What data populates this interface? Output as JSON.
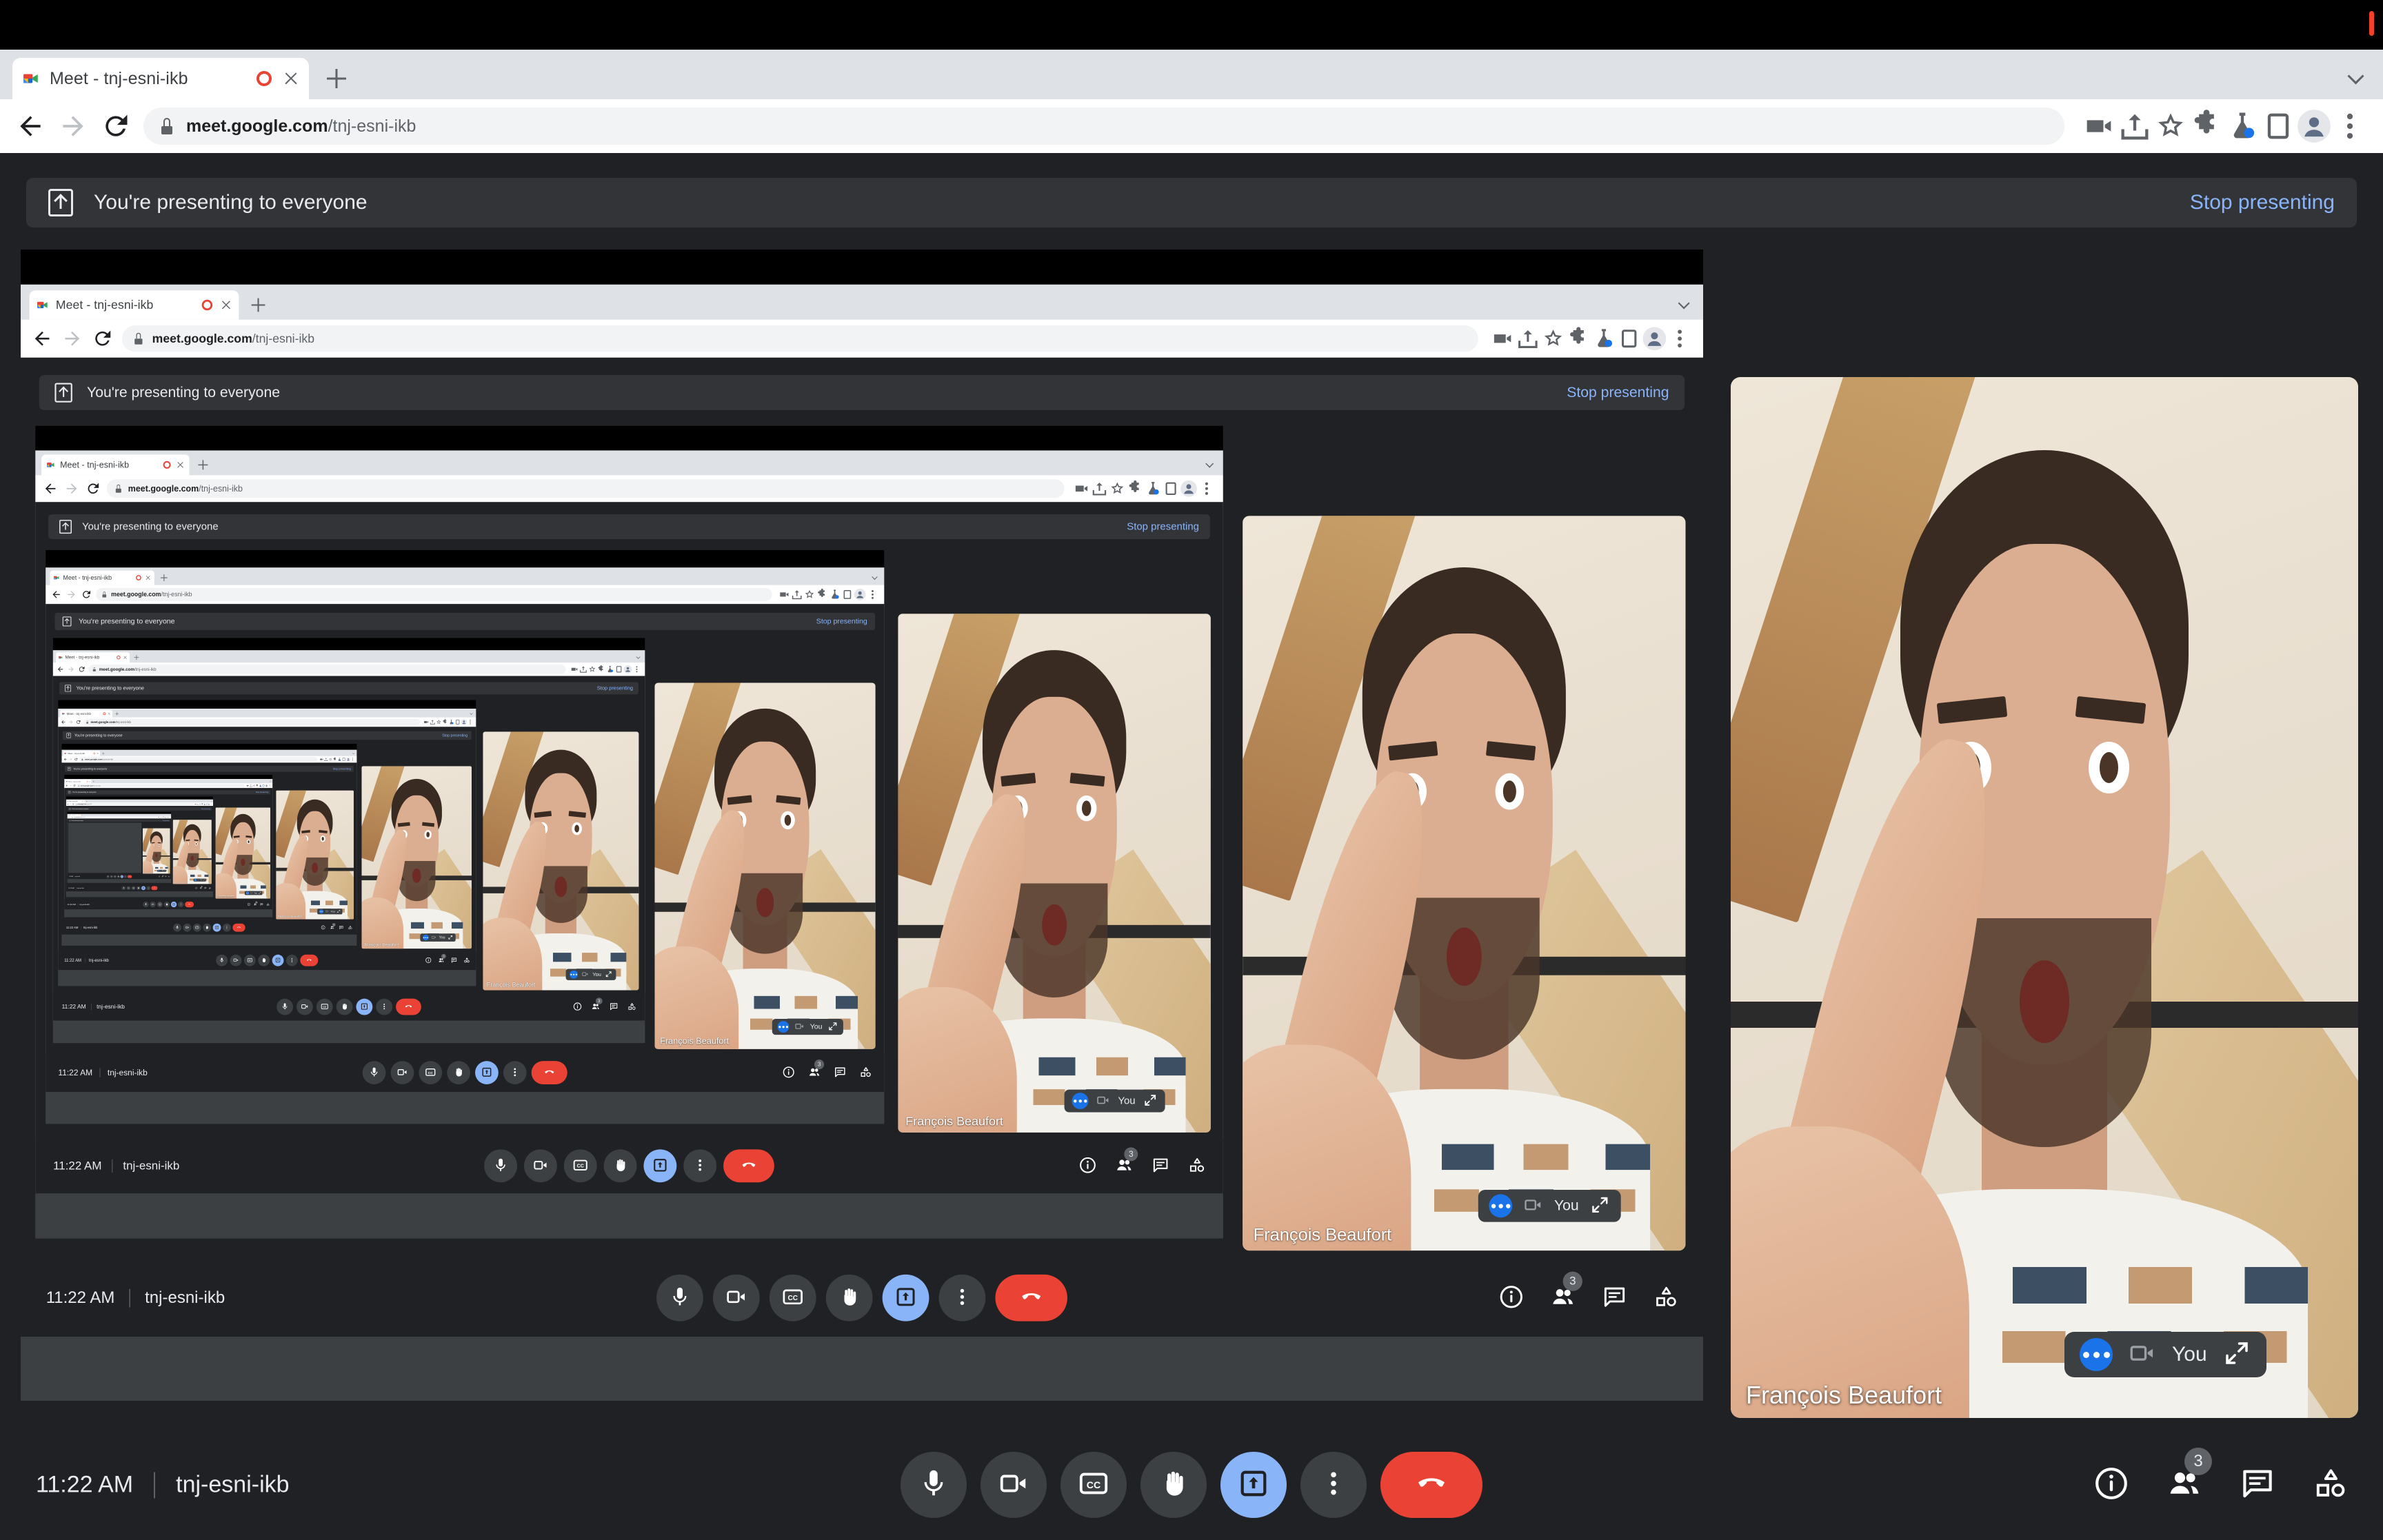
{
  "window": {
    "top_bar_color": "#000000",
    "tab": {
      "title": "Meet - tnj-esni-ikb",
      "favicon_name": "google-meet-favicon",
      "recording_indicator": "recording-dot",
      "close_label": "×"
    },
    "new_tab_label": "+",
    "tabstrip_caret": "chevron-down-icon",
    "nav": {
      "back": "back-arrow-icon",
      "forward": "forward-arrow-icon",
      "reload": "reload-icon"
    },
    "omnibox": {
      "lock": "lock-icon",
      "url_domain": "meet.google.com",
      "url_path": "/tnj-esni-ikb",
      "full_url": "meet.google.com/tnj-esni-ikb"
    },
    "toolbar_icons": [
      {
        "name": "media-cast-icon",
        "label": "Media"
      },
      {
        "name": "share-icon",
        "label": "Share"
      },
      {
        "name": "bookmark-star-icon",
        "label": "Bookmark"
      },
      {
        "name": "extensions-puzzle-icon",
        "label": "Extensions"
      },
      {
        "name": "experiments-flask-icon",
        "label": "Experiments"
      },
      {
        "name": "side-panel-icon",
        "label": "Side panel"
      },
      {
        "name": "profile-avatar-icon",
        "label": "Profile"
      },
      {
        "name": "chrome-menu-icon",
        "label": "Customize and control Google Chrome"
      }
    ]
  },
  "meet": {
    "banner": {
      "icon": "present-to-everyone-icon",
      "text": "You're presenting to everyone",
      "stop_label": "Stop presenting",
      "stop_color": "#8ab4f8",
      "background": "#323438"
    },
    "footer": {
      "time": "11:22 AM",
      "meeting_code": "tnj-esni-ikb"
    },
    "controls": [
      {
        "name": "microphone-button",
        "icon": "microphone-icon",
        "state": "off-style",
        "active": false
      },
      {
        "name": "camera-button",
        "icon": "video-camera-icon",
        "state": "off-style",
        "active": false
      },
      {
        "name": "captions-button",
        "icon": "closed-captions-icon",
        "state": "off-style",
        "active": false
      },
      {
        "name": "raise-hand-button",
        "icon": "raised-hand-icon",
        "state": "off-style",
        "active": false
      },
      {
        "name": "present-now-button",
        "icon": "present-screen-icon",
        "state": "active",
        "active": true
      },
      {
        "name": "more-options-button",
        "icon": "three-dots-vertical-icon",
        "state": "off-style",
        "active": false
      },
      {
        "name": "leave-call-button",
        "icon": "hang-up-icon",
        "state": "danger",
        "active": false
      }
    ],
    "right_controls": [
      {
        "name": "meeting-details-button",
        "icon": "info-circle-icon",
        "badge": null
      },
      {
        "name": "participants-button",
        "icon": "people-icon",
        "badge": "3"
      },
      {
        "name": "chat-button",
        "icon": "chat-bubble-icon",
        "badge": null
      },
      {
        "name": "activities-button",
        "icon": "shapes-activities-icon",
        "badge": null
      }
    ],
    "self_pill": {
      "status_icon": "more-dots-blue-icon",
      "camera_icon": "video-camera-outline-icon",
      "label": "You",
      "expand_icon": "expand-diagonal-icon"
    },
    "participant": {
      "name": "François Beaufort"
    },
    "colors": {
      "app_background": "#202124",
      "surface": "#3c4043",
      "accent_blue": "#8ab4f8",
      "danger_red": "#ea4335",
      "text": "#e8eaed"
    }
  },
  "recursion": {
    "description": "Screen share showing the same Meet window recursively (Droste effect)",
    "levels": 9
  }
}
